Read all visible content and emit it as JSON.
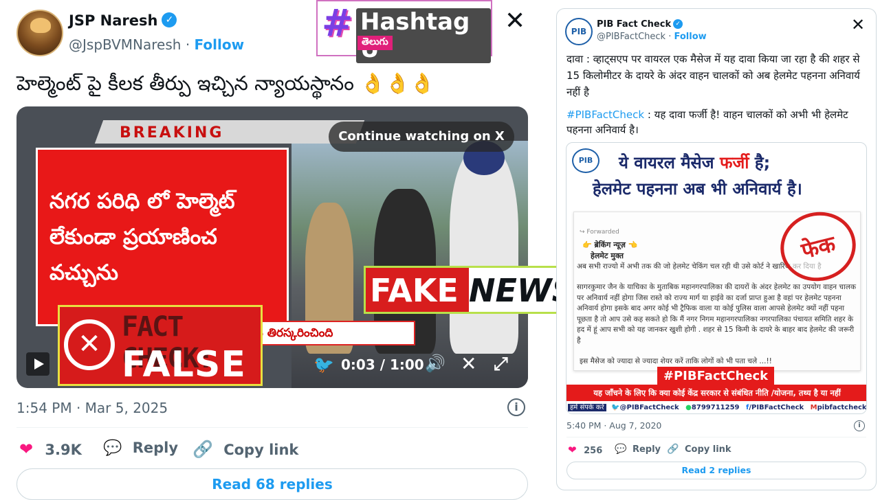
{
  "left_tweet": {
    "display_name": "JSP Naresh",
    "handle": "@JspBVMNaresh",
    "separator": "·",
    "follow_label": "Follow",
    "text": "హెల్మెంట్ పై కీలక తీర్పు ఇచ్చిన న్యాయస్థానం 👌👌👌",
    "timestamp": "1:54 PM · Mar 5, 2025",
    "likes": "3.9K",
    "reply_label": "Reply",
    "copy_link_label": "Copy link",
    "read_replies_label": "Read 68 replies",
    "video": {
      "breaking_label": "BREAKING",
      "headline": "నగర పరిధి లో హెల్మెట్ లేకుండా ప్రయాణించ వచ్చును",
      "ticker": "ట్ తీర్పు కోర్టు తిరస్కరించింది",
      "continue_label": "Continue watching on X",
      "time": "0:03 / 1:00"
    }
  },
  "hashtag_logo": {
    "hash": "#",
    "word": "Hashtag U",
    "sub": "తెలుగు"
  },
  "fact_check_stamp": {
    "top": "FACT CHECK:",
    "bottom": "FALSE"
  },
  "fake_news_stamp": {
    "fake": "FAKE",
    "news": "NEWS"
  },
  "right_tweet": {
    "display_name": "PIB Fact Check",
    "handle": "@PIBFactCheck",
    "separator": "·",
    "follow_label": "Follow",
    "avatar_text": "PIB",
    "claim": "दावा : व्हाट्सएप पर वायरल एक मैसेज में यह दावा किया जा रहा है की शहर से 15 किलोमीटर के दायरे के अंदर वाहन चालकों को अब हेलमेट पहनना अनिवार्य नहीं है",
    "hashtag": "#PIBFactCheck",
    "verdict": " : यह दावा फर्जी है! वाहन चालकों को अभी भी हेलमेट पहनना अनिवार्य है।",
    "timestamp": "5:40 PM · Aug 7, 2020",
    "likes": "256",
    "reply_label": "Reply",
    "copy_link_label": "Copy link",
    "read_replies_label": "Read 2 replies",
    "image": {
      "logo": "PIB",
      "headline_pre": "ये वायरल मैसेज ",
      "headline_fake": "फर्जी",
      "headline_post": " है;",
      "headline2": "हेलमेट पहनना अब भी अनिवार्य है।",
      "forwarded": "↪ Forwarded",
      "msg_title": "👉 ब्रेकिंग न्यूज़ 👈",
      "msg_subtitle": "हेलमेट मुक्त",
      "msg_line1": "अब सभी राज्यो में अभी तक की जो हेलमेट चेकिंग चल रही थी उसे कोर्ट ने खारिज कर दिया है",
      "msg_line2": "सागरकुमार जैन के याचिका के मुताबिक महानगरपालिका की दायरों के अंदर हेलमेट का उपयोग वाहन चालक पर अनिवार्य नहीं होगा जिस रास्ते को राज्य मार्ग या हाईवे का दर्जा प्राप्त हुआ है वहां पर हेलमेट पहनना अनिवार्य होगा इसके बाद अगर कोई भी ट्रैफिक वाला या कोई पुलिस वाला आपसे हेलमेट क्यों नहीं पहना पूछता है तो आप उसे कह सकते हो कि मैं नगर निगम महानगरपालिका नगरपालिका पंचायत समिति शहर के हद में हूं आप सभी को यह जानकर खुशी होगी . शहर से 15 किमी के दायरे के बाहर बाद हेलमेट की जरूरी है",
      "msg_line3": "इस मैसेज को ज्यादा से ज्यादा शेयर करें ताकि लोगों को भी पता चले ...!!",
      "seal": "फेक",
      "hashtag_banner": "#PIBFactCheck",
      "band_text": "यह जाँचने के लिए कि क्या कोई केंद्र सरकार से संबंधित नीति /योजना, तथ्य है या नहीं",
      "contact_label": "हमें संपर्क करें",
      "contact_twitter": "@PIBFactCheck",
      "contact_whatsapp": "8799711259",
      "contact_facebook": "/PIBFactCheck",
      "contact_email": "pibfactcheck@gmail.com"
    }
  },
  "icons": {
    "verified": "✓",
    "x_logo": "𝕏",
    "heart": "❤",
    "reply": "💬",
    "link": "🔗",
    "info": "i",
    "close_x": "✕",
    "volume": "🔊",
    "fullscreen": "⤢",
    "twitter_bird": "🐦"
  },
  "colors": {
    "x_blue": "#1d9bf0",
    "like_pink": "#f91880",
    "fake_red": "#d61b1b",
    "text_gray": "#536471"
  }
}
